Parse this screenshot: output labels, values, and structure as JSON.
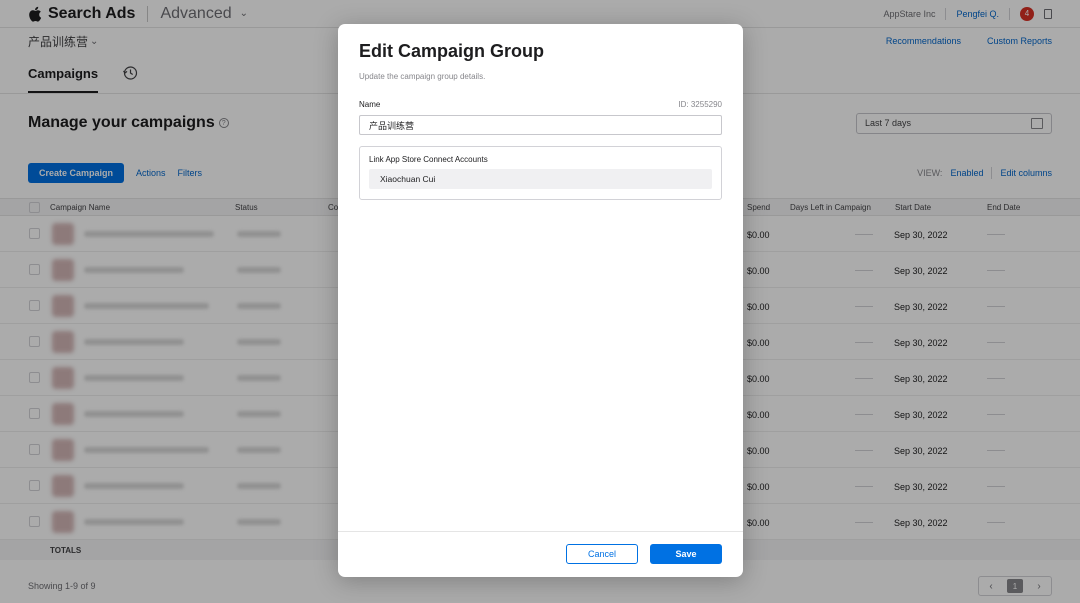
{
  "header": {
    "brand": "Search Ads",
    "product": "Advanced",
    "org": "AppStare Inc",
    "user": "Pengfei Q.",
    "notification_count": "4"
  },
  "subbar": {
    "group_name": "产品训练营",
    "recommendations": "Recommendations",
    "custom_reports": "Custom Reports"
  },
  "tabs": {
    "campaigns": "Campaigns"
  },
  "manage": {
    "title": "Manage your campaigns",
    "date_range": "Last 7 days"
  },
  "actions": {
    "create": "Create Campaign",
    "actions": "Actions",
    "filters": "Filters",
    "view_label": "VIEW:",
    "view_value": "Enabled",
    "edit_columns": "Edit columns"
  },
  "table": {
    "columns": [
      "Campaign Name",
      "Status",
      "Co",
      "Spend",
      "Days Left in Campaign",
      "Start Date",
      "End Date"
    ],
    "rows": [
      {
        "spend": "$0.00",
        "start_date": "Sep 30, 2022"
      },
      {
        "spend": "$0.00",
        "start_date": "Sep 30, 2022"
      },
      {
        "spend": "$0.00",
        "start_date": "Sep 30, 2022"
      },
      {
        "spend": "$0.00",
        "start_date": "Sep 30, 2022"
      },
      {
        "spend": "$0.00",
        "start_date": "Sep 30, 2022"
      },
      {
        "spend": "$0.00",
        "start_date": "Sep 30, 2022"
      },
      {
        "spend": "$0.00",
        "start_date": "Sep 30, 2022"
      },
      {
        "spend": "$0.00",
        "start_date": "Sep 30, 2022"
      },
      {
        "spend": "$0.00",
        "start_date": "Sep 30, 2022"
      }
    ],
    "totals_label": "TOTALS"
  },
  "footer": {
    "showing": "Showing 1-9 of 9",
    "current_page": "1"
  },
  "modal": {
    "title": "Edit Campaign Group",
    "subtitle": "Update the campaign group details.",
    "name_label": "Name",
    "id_label": "ID: 3255290",
    "name_value": "产品训练营",
    "link_title": "Link App Store Connect Accounts",
    "account": "Xiaochuan Cui",
    "cancel": "Cancel",
    "save": "Save"
  }
}
